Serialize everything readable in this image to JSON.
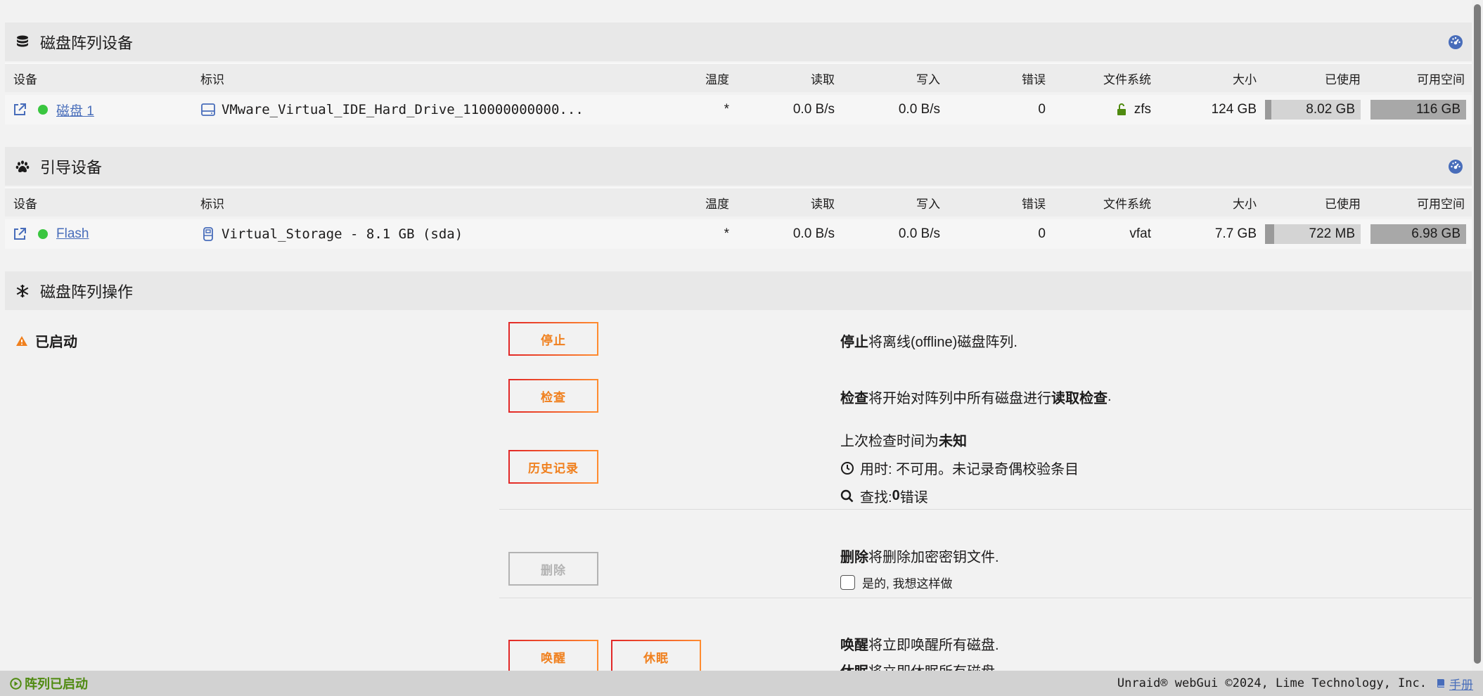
{
  "array_devices": {
    "title": "磁盘阵列设备",
    "columns": [
      "设备",
      "标识",
      "温度",
      "读取",
      "写入",
      "错误",
      "文件系统",
      "大小",
      "已使用",
      "可用空间"
    ],
    "rows": [
      {
        "device": "磁盘 1",
        "identity": "VMware_Virtual_IDE_Hard_Drive_110000000000...",
        "temp": "*",
        "read": "0.0 B/s",
        "write": "0.0 B/s",
        "errors": "0",
        "fs": "zfs",
        "size": "124 GB",
        "used": "8.02 GB",
        "used_fraction": 0.065,
        "free": "116 GB"
      }
    ]
  },
  "boot_device": {
    "title": "引导设备",
    "columns": [
      "设备",
      "标识",
      "温度",
      "读取",
      "写入",
      "错误",
      "文件系统",
      "大小",
      "已使用",
      "可用空间"
    ],
    "rows": [
      {
        "device": "Flash",
        "identity": "Virtual_Storage - 8.1 GB (sda)",
        "temp": "*",
        "read": "0.0 B/s",
        "write": "0.0 B/s",
        "errors": "0",
        "fs": "vfat",
        "size": "7.7 GB",
        "used": "722 MB",
        "used_fraction": 0.094,
        "free": "6.98 GB"
      }
    ]
  },
  "operations": {
    "title": "磁盘阵列操作",
    "status": "已启动",
    "stop": {
      "label": "停止",
      "desc_bold": "停止",
      "desc": " 将离线(offline)磁盘阵列."
    },
    "check": {
      "label": "检查",
      "desc_bold": "检查",
      "desc_pre": " 将开始对阵列中所有磁盘进行",
      "desc_bold2": "读取检查",
      "desc_post": "."
    },
    "history": {
      "label": "历史记录",
      "last_check_pre": "上次检查时间为",
      "last_check_val": "未知",
      "duration": "用时: 不可用。未记录奇偶校验条目",
      "found_pre": "查找: ",
      "found_val": "0",
      "found_post": "错误"
    },
    "delete": {
      "label": "删除",
      "desc_bold": "删除",
      "desc": " 将删除加密密钥文件.",
      "confirm": "是的, 我想这样做"
    },
    "wake": {
      "label": "唤醒",
      "desc_bold": "唤醒",
      "desc": " 将立即唤醒所有磁盘."
    },
    "sleep": {
      "label": "休眠",
      "desc_bold": "休眠",
      "desc": " 将立即休眠所有磁盘."
    }
  },
  "footer": {
    "status": "阵列已启动",
    "copyright": "Unraid® webGui ©2024, Lime Technology, Inc.",
    "manual": "手册"
  },
  "colors": {
    "accent": "#486dba",
    "online": "#3ac640",
    "warning": "#f0801e",
    "button_border": "#e22828"
  }
}
